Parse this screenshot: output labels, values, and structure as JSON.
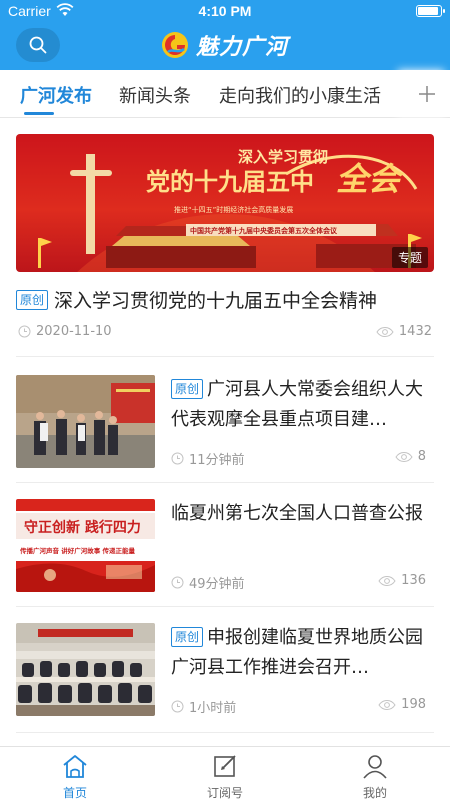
{
  "status_bar": {
    "carrier": "Carrier",
    "time": "4:10 PM"
  },
  "nav": {
    "brand": "魅力广河",
    "icons": [
      "search-icon",
      "brand-logo"
    ]
  },
  "tabs": [
    {
      "label": "广河发布",
      "active": true
    },
    {
      "label": "新闻头条",
      "active": false
    },
    {
      "label": "走向我们的小康生活",
      "active": false
    }
  ],
  "featured": {
    "banner_text": {
      "line1": "深入学习贯彻",
      "line2": "党的十九届五中",
      "line3": "全会",
      "subtitle": "推进“十四五”时期经济社会高质量发展",
      "caption": "中国共产党第十九届中央委员会第五次全体会议"
    },
    "tag": "专题",
    "badge": "原创",
    "title": "深入学习贯彻党的十九届五中全会精神",
    "date": "2020-11-10",
    "views": "1432"
  },
  "articles": [
    {
      "badge": "原创",
      "title": "广河县人大常委会组织人大代表观摩全县重点项目建…",
      "time": "11分钟前",
      "views": "8"
    },
    {
      "badge": "",
      "title": "临夏州第七次全国人口普查公报",
      "time": "49分钟前",
      "views": "136",
      "thumb_text": {
        "line1": "守正创新 践行四力",
        "line2": "传播广河声音 讲好广河故事 传递正能量"
      }
    },
    {
      "badge": "原创",
      "title": "申报创建临夏世界地质公园广河县工作推进会召开…",
      "time": "1小时前",
      "views": "198"
    }
  ],
  "bottom_tabs": [
    {
      "label": "首页",
      "icon": "home-icon",
      "active": true
    },
    {
      "label": "订阅号",
      "icon": "edit-icon",
      "active": false
    },
    {
      "label": "我的",
      "icon": "user-icon",
      "active": false
    }
  ],
  "colors": {
    "nav_bg": "#2aa0ee",
    "accent": "#2187d9",
    "banner_red": "#d6201c"
  }
}
